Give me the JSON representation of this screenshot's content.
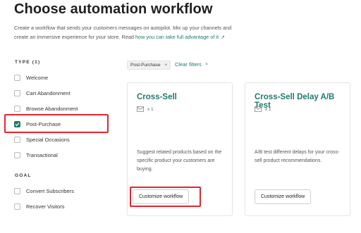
{
  "header": {
    "title": "Choose automation workflow",
    "description": "Create a workflow that sends your customers messages on autopilot. Mix up your channels and create an immersive experience for your store. Read",
    "link_text": "how you can take full advantage of it"
  },
  "sidebar": {
    "type_heading": "TYPE (1)",
    "type_items": [
      {
        "label": "Welcome",
        "checked": false
      },
      {
        "label": "Cart Abandonment",
        "checked": false
      },
      {
        "label": "Browse Abandonment",
        "checked": false
      },
      {
        "label": "Post-Purchase",
        "checked": true
      },
      {
        "label": "Special Occasions",
        "checked": false
      },
      {
        "label": "Transactional",
        "checked": false
      }
    ],
    "goal_heading": "GOAL",
    "goal_items": [
      {
        "label": "Convert Subscribers",
        "checked": false
      },
      {
        "label": "Recover Visitors",
        "checked": false
      }
    ]
  },
  "filters": {
    "active_chip": "Post-Purchase",
    "chip_close": "×",
    "clear_label": "Clear filters",
    "clear_close": "×"
  },
  "cards": [
    {
      "title": "Cross-Sell",
      "channel_icon": "email-icon",
      "count": "x 1",
      "description": "Suggest related products based on the specific product your customers are buying.",
      "button": "Customize workflow"
    },
    {
      "title": "Cross-Sell Delay A/B Test",
      "channel_icon": "email-icon",
      "count": "x 1",
      "description": "A/B test different delays for your cross-sell product recommendations.",
      "button": "Customize workflow"
    }
  ],
  "colors": {
    "accent": "#1f7a70",
    "highlight": "#e6242f"
  }
}
